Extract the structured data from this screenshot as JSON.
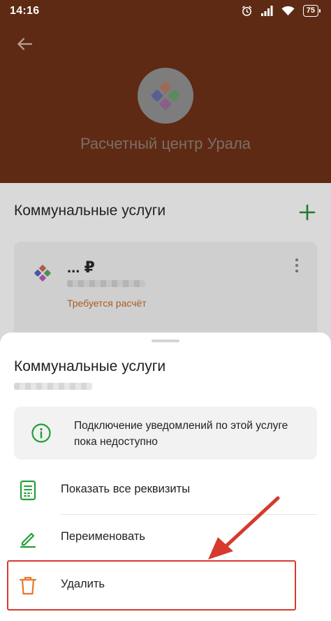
{
  "status_bar": {
    "time": "14:16",
    "battery": "75",
    "icons": [
      "alarm-icon",
      "signal-icon",
      "wifi-icon",
      "battery-icon"
    ]
  },
  "header": {
    "company_name": "Расчетный центр Урала",
    "back_icon": "arrow-left-icon"
  },
  "section": {
    "title": "Коммунальные услуги",
    "add_icon": "plus-icon"
  },
  "service_card": {
    "amount": "... ₽",
    "status": "Требуется расчёт",
    "menu_icon": "more-vert-icon"
  },
  "sheet": {
    "title": "Коммунальные услуги",
    "info": {
      "text": "Подключение уведомлений по этой услуге пока недоступно",
      "icon": "info-icon"
    },
    "actions": [
      {
        "label": "Показать все реквизиты",
        "icon": "receipt-icon"
      },
      {
        "label": "Переименовать",
        "icon": "pencil-icon"
      },
      {
        "label": "Удалить",
        "icon": "trash-icon"
      }
    ]
  },
  "colors": {
    "brand_green": "#21a038",
    "delete_orange": "#e8762c",
    "annotation_red": "#d63a2d",
    "header_brown": "#5e2a13"
  }
}
